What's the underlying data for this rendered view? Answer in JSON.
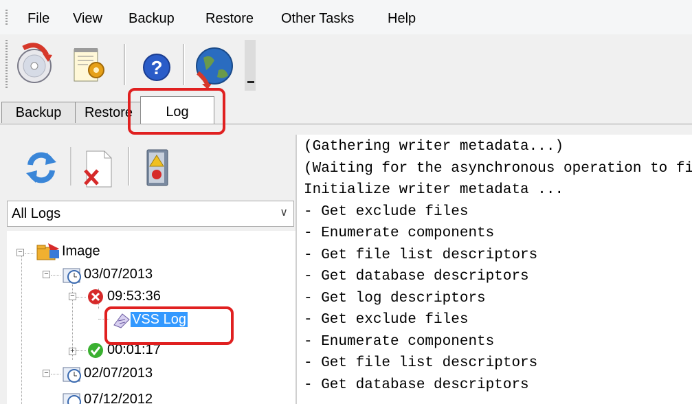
{
  "menu": [
    "File",
    "View",
    "Backup",
    "Restore",
    "Other Tasks",
    "Help"
  ],
  "toolbar": {
    "buttons": [
      "disc-backup-icon",
      "settings-document-icon",
      "help-icon",
      "globe-icon"
    ]
  },
  "tabs": [
    {
      "label": "Backup"
    },
    {
      "label": "Restore"
    },
    {
      "label": "Log",
      "active": true
    }
  ],
  "log_toolbar": [
    "refresh-icon",
    "delete-log-icon",
    "log-report-icon"
  ],
  "filter": {
    "selected": "All Logs"
  },
  "tree": {
    "root": "Image",
    "dates": [
      {
        "date": "03/07/2013",
        "items": [
          {
            "time": "09:53:36",
            "status": "error",
            "child": "VSS Log"
          },
          {
            "time": "00:01:17",
            "status": "success"
          }
        ]
      },
      {
        "date": "02/07/2013"
      },
      {
        "date": "07/12/2012"
      }
    ]
  },
  "log_lines": [
    "(Gathering writer metadata...)",
    "(Waiting for the asynchronous operation to finish...)",
    "Initialize writer metadata ...",
    "- Get exclude files",
    "- Enumerate components",
    "- Get file list descriptors",
    "- Get database descriptors",
    "- Get log descriptors",
    "- Get exclude files",
    "- Enumerate components",
    "- Get file list descriptors",
    "- Get database descriptors"
  ],
  "colors": {
    "highlight": "#e02020",
    "selection": "#3399ff"
  }
}
